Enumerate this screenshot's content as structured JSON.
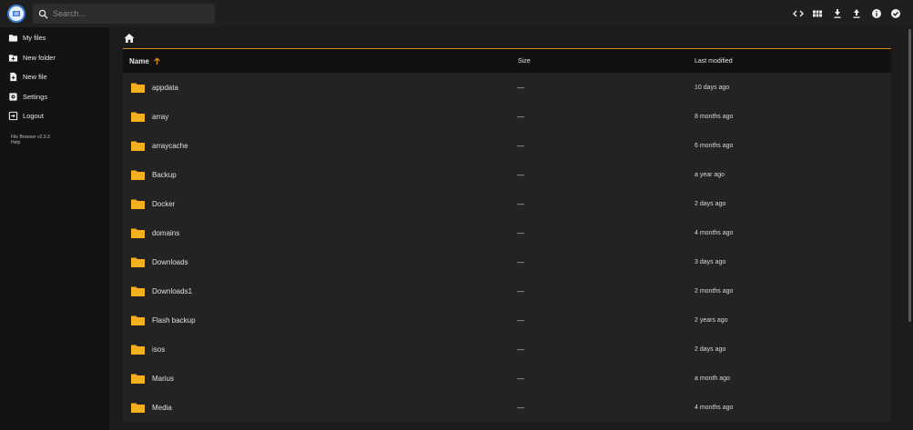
{
  "search": {
    "placeholder": "Search..."
  },
  "toolbar": {
    "icons": [
      "code-icon",
      "grid-view-icon",
      "download-icon",
      "upload-icon",
      "info-icon",
      "select-check-icon"
    ]
  },
  "sidebar": {
    "items": [
      {
        "label": "My files",
        "icon": "folder-icon"
      },
      {
        "label": "New folder",
        "icon": "new-folder-icon"
      },
      {
        "label": "New file",
        "icon": "new-file-icon"
      },
      {
        "label": "Settings",
        "icon": "settings-icon"
      },
      {
        "label": "Logout",
        "icon": "logout-icon"
      }
    ],
    "credit": "File Browser v2.0.3",
    "help": "Help"
  },
  "breadcrumb": {
    "icon": "home-icon"
  },
  "listing": {
    "headers": {
      "name": "Name",
      "size": "Size",
      "modified": "Last modified"
    },
    "rows": [
      {
        "name": "appdata",
        "size": "—",
        "modified": "10 days ago"
      },
      {
        "name": "array",
        "size": "—",
        "modified": "8 months ago"
      },
      {
        "name": "arraycache",
        "size": "—",
        "modified": "6 months ago"
      },
      {
        "name": "Backup",
        "size": "—",
        "modified": "a year ago"
      },
      {
        "name": "Docker",
        "size": "—",
        "modified": "2 days ago"
      },
      {
        "name": "domains",
        "size": "—",
        "modified": "4 months ago"
      },
      {
        "name": "Downloads",
        "size": "—",
        "modified": "3 days ago"
      },
      {
        "name": "Downloads1",
        "size": "—",
        "modified": "2 months ago"
      },
      {
        "name": "Flash backup",
        "size": "—",
        "modified": "2 years ago"
      },
      {
        "name": "isos",
        "size": "—",
        "modified": "2 days ago"
      },
      {
        "name": "Marius",
        "size": "—",
        "modified": "a month ago"
      },
      {
        "name": "Media",
        "size": "—",
        "modified": "4 months ago"
      }
    ]
  },
  "colors": {
    "accent": "#d48a1a",
    "folder": "#f2b01e",
    "background": "#1f1f1f"
  }
}
